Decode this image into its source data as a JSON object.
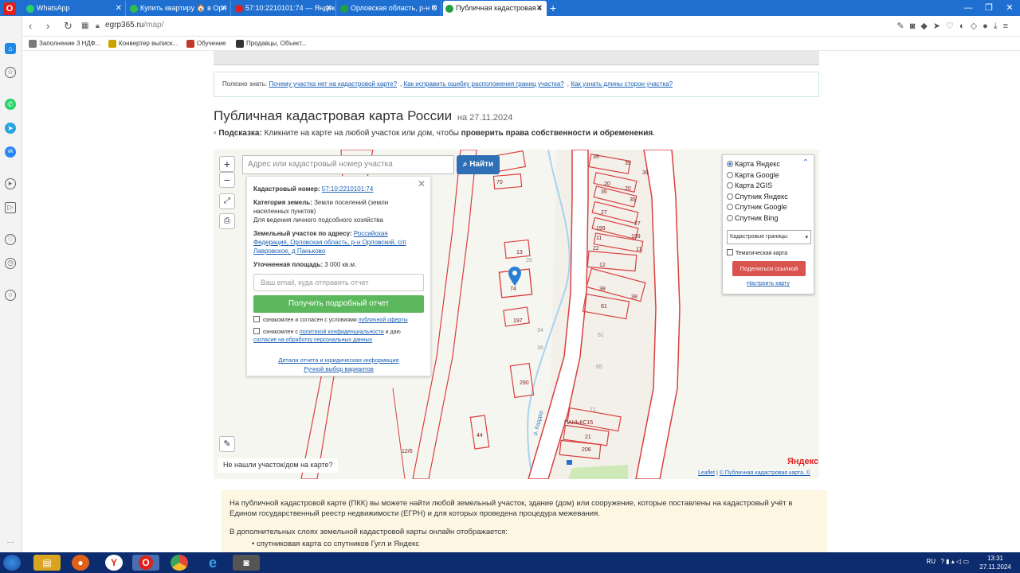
{
  "tabs": [
    {
      "title": "WhatsApp",
      "color": "#25d366"
    },
    {
      "title": "Купить квартиру 🏠 в Орл",
      "color": "#2cbf4c"
    },
    {
      "title": "57:10:2210101:74 — Яндекс",
      "color": "#e02020"
    },
    {
      "title": "Орловская область, р-н О",
      "color": "#22a043"
    },
    {
      "title": "Публичная кадастровая к",
      "color": "#22a043"
    }
  ],
  "address": {
    "domain": "egrp365.ru",
    "path": "/map/"
  },
  "bookmarks": [
    {
      "label": "Заполнение 3 НДФ...",
      "color": "#7a7a7a"
    },
    {
      "label": "Конвертер выписк...",
      "color": "#c9a400"
    },
    {
      "label": "Обучение",
      "color": "#c0392b"
    },
    {
      "label": "Продавцы, Объект...",
      "color": "#333333"
    }
  ],
  "useful": {
    "label": "Полезно знать:",
    "links": [
      "Почему участка нет на кадастровой карте?",
      "Как исправить ошибку расположения границ участка?",
      "Как узнать длины сторон участка?"
    ]
  },
  "page": {
    "title": "Публичная кадастровая карта России",
    "date": "на 27.11.2024",
    "hint_label": "Подсказка:",
    "hint_text": "Кликните на карте на любой участок или дом, чтобы",
    "hint_bold": "проверить права собственности и обременения",
    "hint_end": "."
  },
  "search": {
    "placeholder": "Адрес или кадастровый номер участка",
    "button": "Найти"
  },
  "card": {
    "cad_label": "Кадастровый номер:",
    "cad_value": "57:10:2210101:74",
    "cat_label": "Категория земель:",
    "cat_value": "Земли поселений (земли населенных пунктов)",
    "use_value": "Для ведения личного подсобного хозяйства",
    "addr_label": "Земельный участок по адресу:",
    "addr_value": "Российская Федерация, Орловская область, р-н Орловский, с/п Лавровское, д Паньково",
    "area_label": "Уточненная площадь:",
    "area_value": "3 000 кв.м.",
    "email_placeholder": "Ваш email, куда отправить отчет",
    "report_button": "Получить подробный отчет",
    "chk1_text": "ознакомлен и согласен с условиями",
    "chk1_link": "публичной оферты",
    "chk2_text": "ознакомлен с",
    "chk2_link": "политикой конфиденциальности",
    "chk2_text2": "и даю",
    "chk2_link2": "согласие на обработку персональных данных",
    "details_link": "Детали отчета и юридическая информация",
    "manual_link": "Ручной выбор вариантов"
  },
  "layers": {
    "options": [
      "Карта Яндекс",
      "Карта Google",
      "Карта 2GIS",
      "Спутник Яндекс",
      "Спутник Google",
      "Спутник Bing"
    ],
    "selected": "Карта Яндекс",
    "select_value": "Кадастровые границы",
    "thematic": "Тематическая карта",
    "share": "Поделиться ссылкой",
    "setup": "Настроить карту"
  },
  "map": {
    "not_found": "Не нашли участок/дом на карте?",
    "brand": "Яндекс",
    "attr_leaflet": "Leaflet",
    "attr_pkk": "© Публичная кадастровая карта, ©",
    "labels": [
      "39",
      "39",
      "39",
      "70",
      "20",
      "35",
      "20",
      "35",
      "27",
      "27",
      "199",
      "199",
      "11",
      "11",
      "22",
      "12",
      "13",
      "74",
      "38",
      "38",
      "61",
      "197",
      "34",
      "36",
      "61",
      "65",
      "290",
      "71",
      "ПАНЬКС15",
      "21",
      "206",
      "44",
      "12/6",
      "р. Каддер",
      "26"
    ]
  },
  "info": {
    "p1": "На публичной кадастровой карте (ПКК) вы можете найти любой земельный участок, здание (дом) или сооружение, которые поставлены на кадастровый учёт в Едином государственный реестр недвижимости (ЕГРН) и для которых проведена процедура межевания.",
    "p2": "В дополнительных слоях земельной кадастровой карты онлайн отображается:",
    "li1": "спутниковая карта со спутников Гугл и Яндекс"
  },
  "tray": {
    "lang": "RU",
    "time": "13:31",
    "date": "27.11.2024"
  }
}
